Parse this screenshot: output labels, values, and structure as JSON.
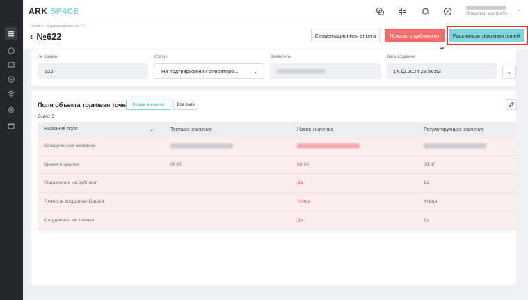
{
  "app": {
    "logo_main": "ARK",
    "logo_accent": "SP4CE"
  },
  "user": {
    "role": "Оператор дистрибу..."
  },
  "header": {
    "breadcrumb": "Заявки на редактирование ТТ",
    "title": "№622",
    "seg_button": "Сегментационная анкета",
    "dup_button": "Показать дубликаты",
    "calc_button": "Рассчитать значения полей"
  },
  "fields": {
    "request_no_label": "№ Заявки",
    "request_no": "622",
    "status_label": "Статус",
    "status": "На подтверждении операторо...",
    "applicant_label": "Заявитель",
    "created_label": "Дата создания",
    "created": "14.12.2024 23:56:53"
  },
  "section": {
    "title": "Поля объекта торговая точка",
    "chip_new": "Новые значения",
    "chip_all": "Все поля",
    "total": "Всего: 5"
  },
  "table": {
    "headers": [
      "Название поля",
      "Текущее значение",
      "Новое значение",
      "Результирующее значение"
    ],
    "rows": [
      {
        "name": "Юридическое название",
        "current": "",
        "new": "",
        "result": ""
      },
      {
        "name": "Время открытия",
        "current": "08:00",
        "new": "08:30",
        "result": "08:30"
      },
      {
        "name": "Подозрение на дубликат",
        "current": "",
        "new": "Да",
        "result": "Да"
      },
      {
        "name": "Точность координат Dadata",
        "current": "",
        "new": "Улица",
        "result": "Улица"
      },
      {
        "name": "Координаты не точные",
        "current": "",
        "new": "Да",
        "result": "Да"
      }
    ]
  },
  "colors": {
    "accent": "#7fd6dc",
    "danger": "#f36b6b",
    "highlight": "#e8322f"
  },
  "icons": [
    "list-icon",
    "circle-icon",
    "layers-icon",
    "user-icon",
    "stack-icon",
    "gear-icon",
    "calendar-icon",
    "copy-icon",
    "grid-icon",
    "bell-icon",
    "compass-icon",
    "chevron-down-icon",
    "back-arrow-icon",
    "edit-icon"
  ]
}
